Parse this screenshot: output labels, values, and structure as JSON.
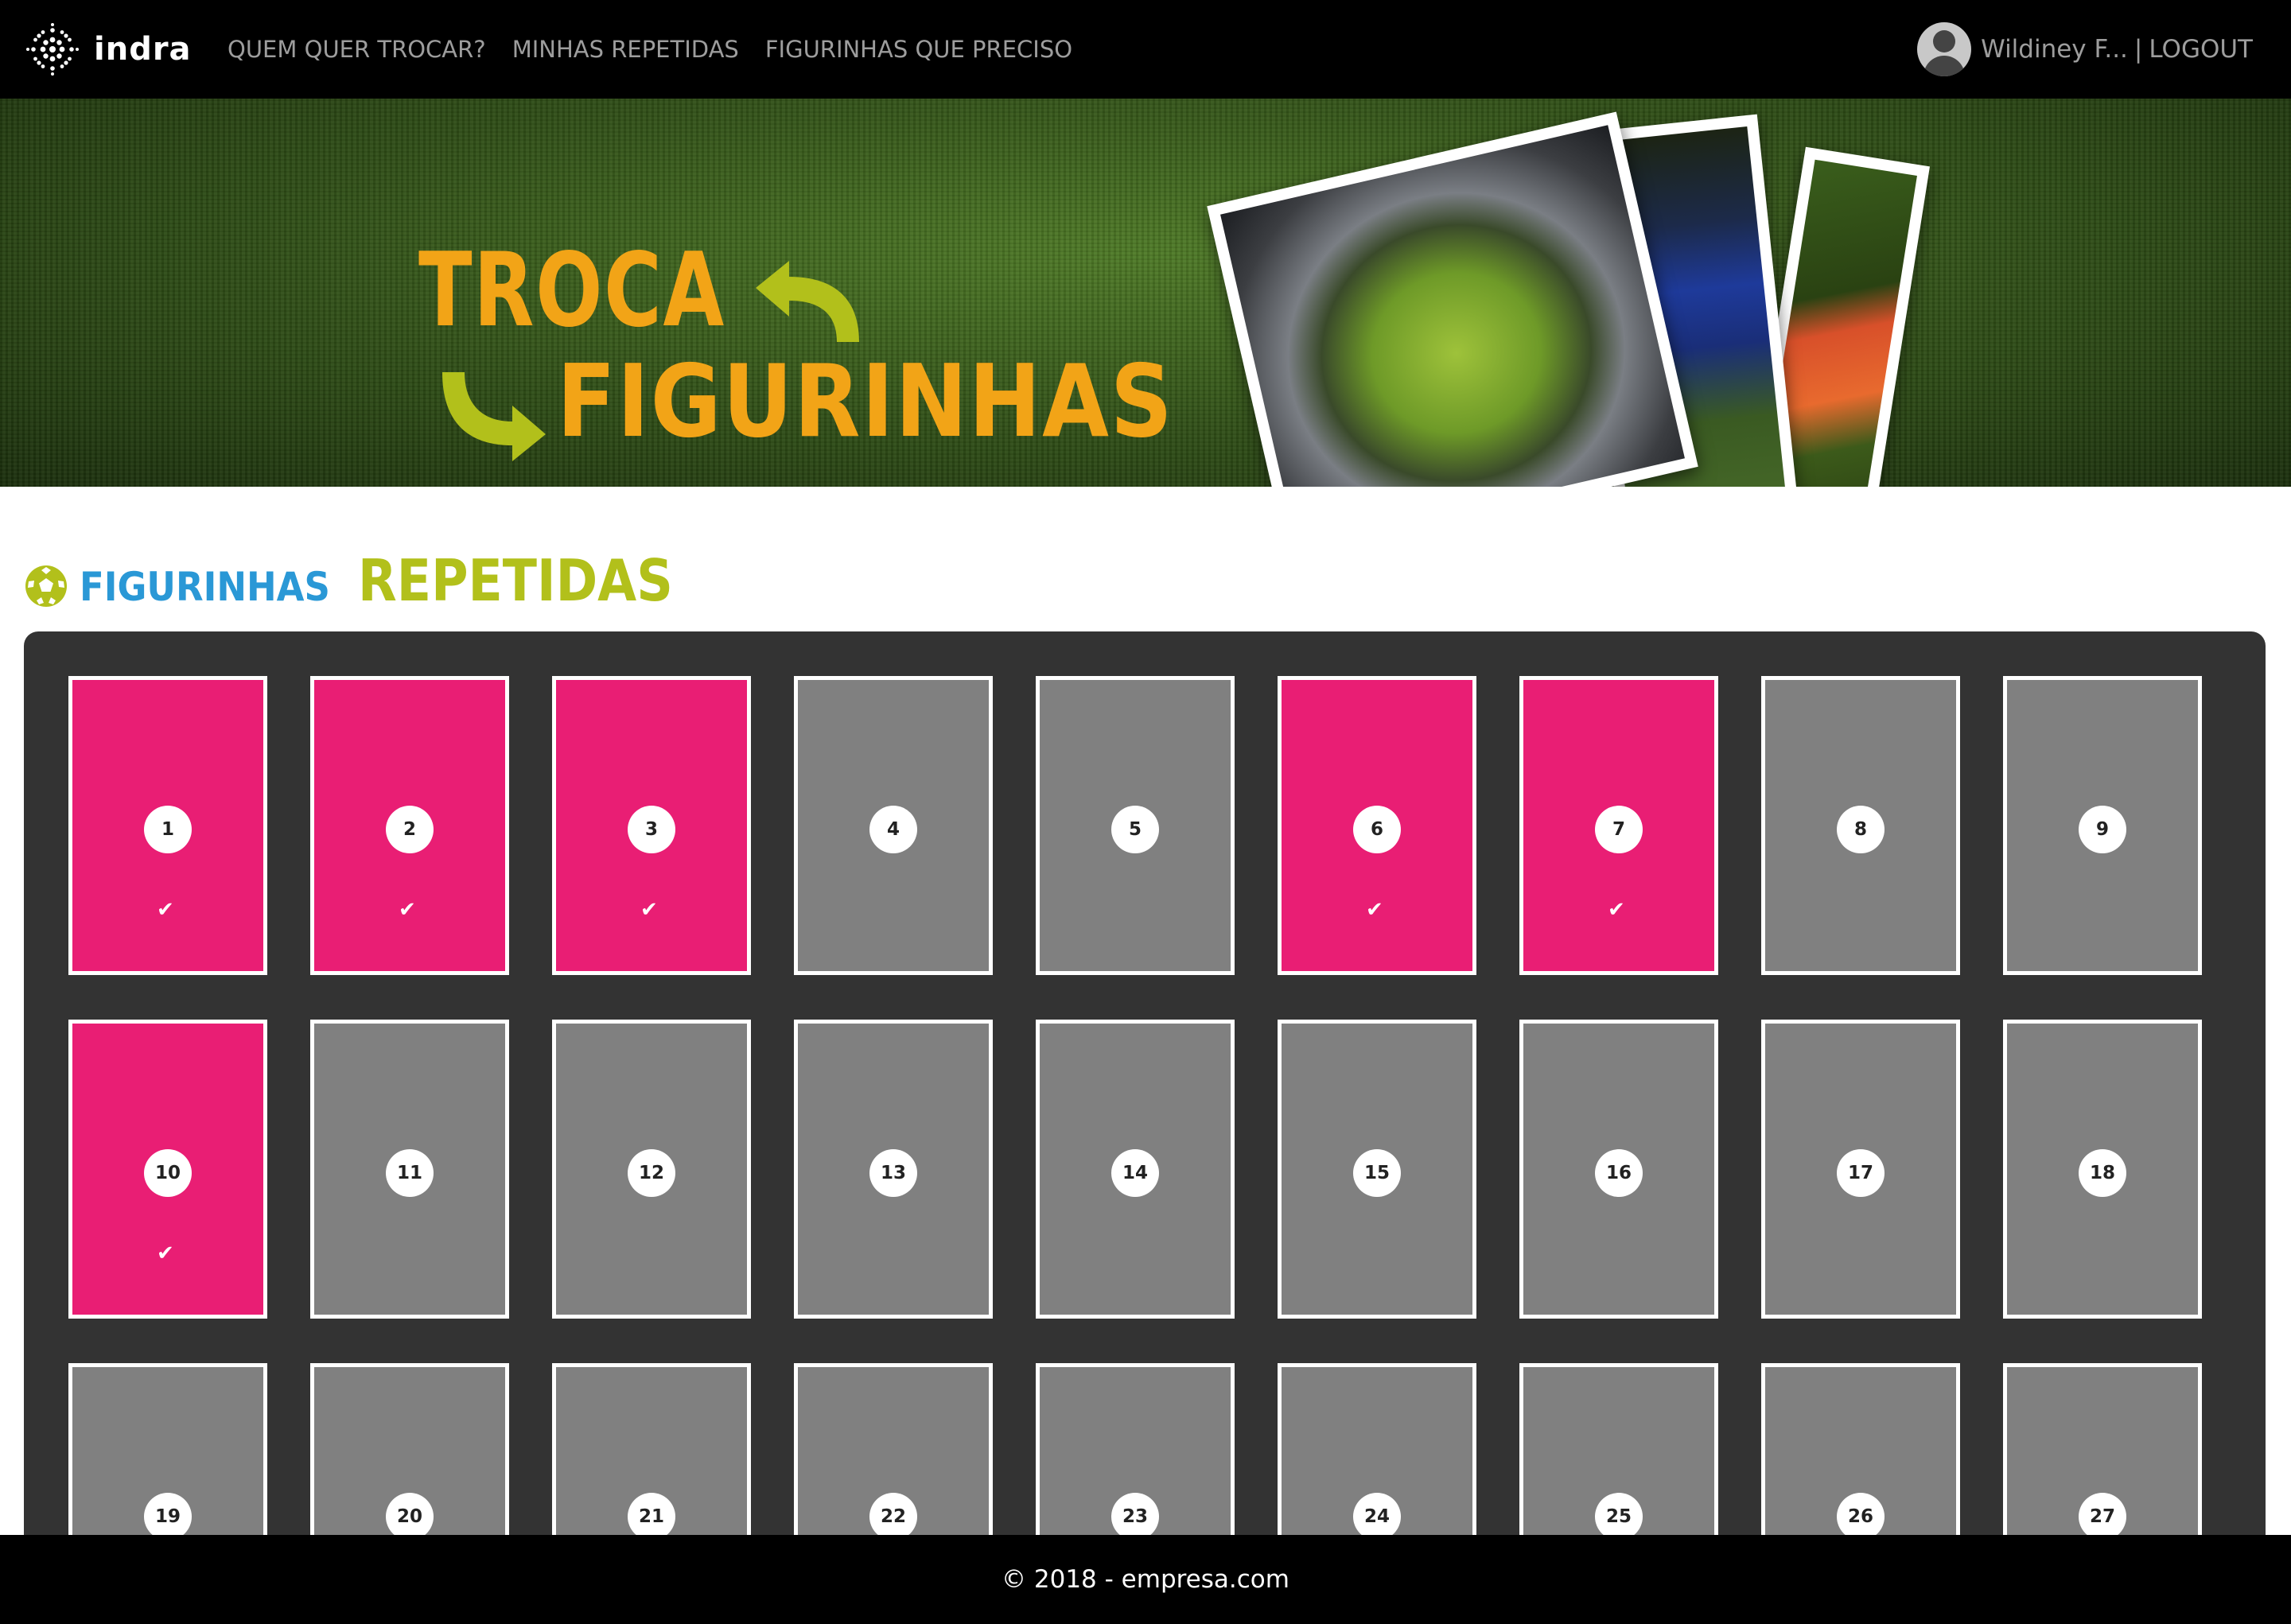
{
  "navbar": {
    "brand": "indra",
    "links": [
      "QUEM QUER TROCAR?",
      "MINHAS REPETIDAS",
      "FIGURINHAS QUE PRECISO"
    ],
    "user_name": "Wildiney F...",
    "separator": "|",
    "logout": "LOGOUT"
  },
  "banner": {
    "line1": "TROCA",
    "line2": "FIGURINHAS"
  },
  "heading": {
    "part1": "FIGURINHAS",
    "part2": "REPETIDAS",
    "icon": "soccer-ball-icon"
  },
  "stickers": [
    {
      "number": "1",
      "repeated": true
    },
    {
      "number": "2",
      "repeated": true
    },
    {
      "number": "3",
      "repeated": true
    },
    {
      "number": "4",
      "repeated": false
    },
    {
      "number": "5",
      "repeated": false
    },
    {
      "number": "6",
      "repeated": true
    },
    {
      "number": "7",
      "repeated": true
    },
    {
      "number": "8",
      "repeated": false
    },
    {
      "number": "9",
      "repeated": false
    },
    {
      "number": "10",
      "repeated": true
    },
    {
      "number": "11",
      "repeated": false
    },
    {
      "number": "12",
      "repeated": false
    },
    {
      "number": "13",
      "repeated": false
    },
    {
      "number": "14",
      "repeated": false
    },
    {
      "number": "15",
      "repeated": false
    },
    {
      "number": "16",
      "repeated": false
    },
    {
      "number": "17",
      "repeated": false
    },
    {
      "number": "18",
      "repeated": false
    },
    {
      "number": "19",
      "repeated": false
    },
    {
      "number": "20",
      "repeated": false
    },
    {
      "number": "21",
      "repeated": false
    },
    {
      "number": "22",
      "repeated": false
    },
    {
      "number": "23",
      "repeated": false
    },
    {
      "number": "24",
      "repeated": false
    },
    {
      "number": "25",
      "repeated": false
    },
    {
      "number": "26",
      "repeated": false
    },
    {
      "number": "27",
      "repeated": false
    }
  ],
  "check_glyph": "✔",
  "colors": {
    "repeated": "#e91e74",
    "not_repeated": "#808080",
    "heading_blue": "#2a98d6",
    "heading_green": "#b2c01b",
    "brand_orange": "#f2a417"
  },
  "footer": {
    "text": "© 2018 - empresa.com"
  }
}
